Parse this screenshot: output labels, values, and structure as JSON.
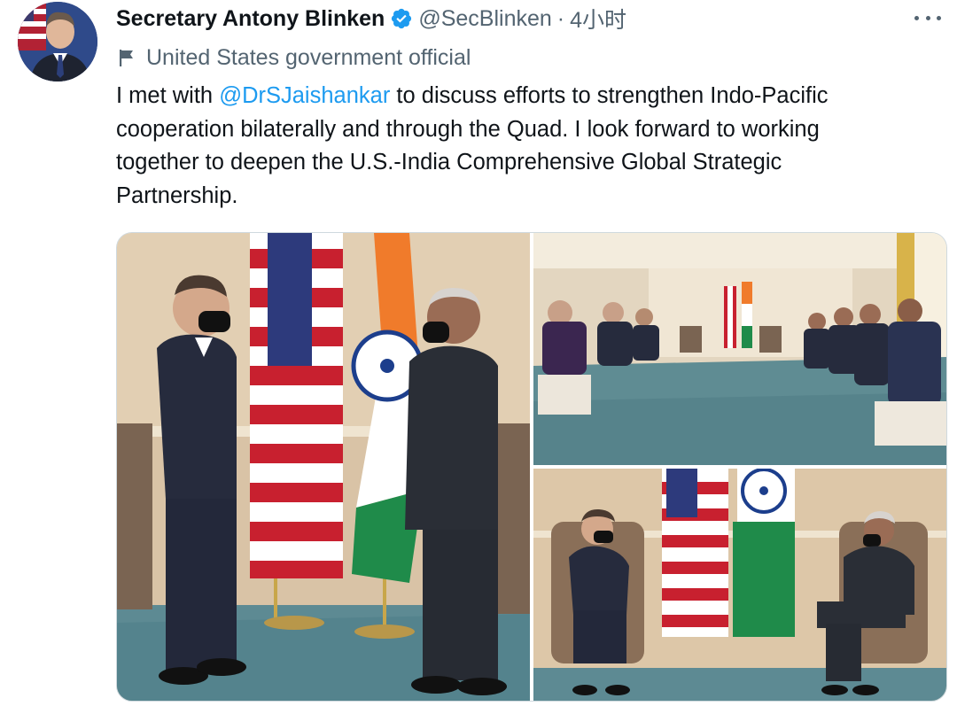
{
  "author": {
    "display_name": "Secretary Antony Blinken",
    "handle": "@SecBlinken",
    "separator": "·",
    "time": "4小时",
    "verified_icon": "verified-badge-icon",
    "label_icon": "flag-icon",
    "label": "United States government official"
  },
  "tweet": {
    "text_before": "I met with ",
    "mention": "@DrSJaishankar",
    "text_after": " to discuss efforts to strengthen Indo-Pacific\ncooperation bilaterally and through the Quad. I look forward to working\ntogether to deepen the U.S.-India Comprehensive Global Strategic\nPartnership."
  },
  "colors": {
    "link": "#1d9bf0",
    "verified": "#1d9bf0",
    "secondary_text": "#536471",
    "primary_text": "#0f1419"
  },
  "media": {
    "photo_count": 3
  }
}
